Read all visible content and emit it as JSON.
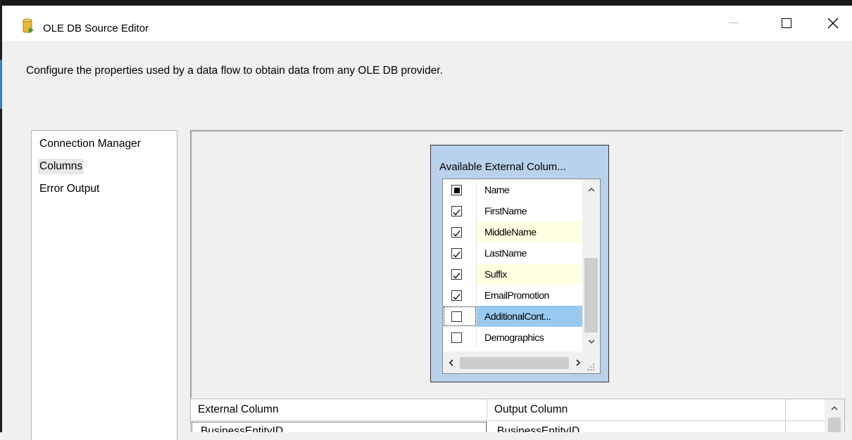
{
  "window": {
    "title": "OLE DB Source Editor",
    "icon": "database-source-icon"
  },
  "description": "Configure the properties used by a data flow to obtain data from any OLE DB provider.",
  "nav": {
    "items": [
      {
        "label": "Connection Manager",
        "selected": false
      },
      {
        "label": "Columns",
        "selected": true
      },
      {
        "label": "Error Output",
        "selected": false
      }
    ]
  },
  "external_columns": {
    "title": "Available External Colum...",
    "header": "Name",
    "rows": [
      {
        "name": "FirstName",
        "checked": true
      },
      {
        "name": "MiddleName",
        "checked": true
      },
      {
        "name": "LastName",
        "checked": true
      },
      {
        "name": "Suffix",
        "checked": true
      },
      {
        "name": "EmailPromotion",
        "checked": true
      },
      {
        "name": "AdditionalCont...",
        "checked": false
      },
      {
        "name": "Demographics",
        "checked": false
      }
    ]
  },
  "mapping_grid": {
    "columns": [
      "External Column",
      "Output Column"
    ],
    "rows": [
      {
        "external": "BusinessEntityID",
        "output": "BusinessEntityID"
      }
    ]
  },
  "colors": {
    "accent": "#3b7bbf",
    "selection": "#99c9ef",
    "alt_row": "#ffffe1",
    "box_bg": "#b9d1ea"
  }
}
